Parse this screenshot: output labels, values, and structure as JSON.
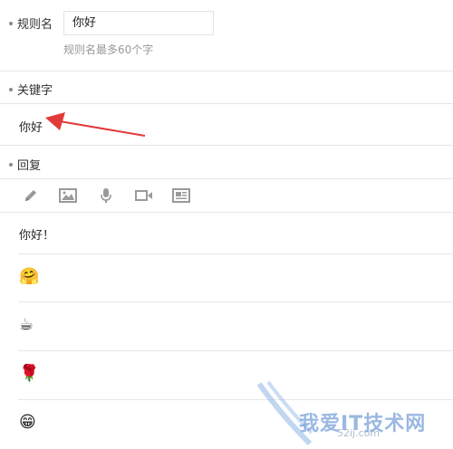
{
  "rule": {
    "label": "规则名",
    "value": "你好",
    "hint": "规则名最多60个字"
  },
  "keywords": {
    "label": "关键字",
    "items": [
      "你好"
    ]
  },
  "reply": {
    "label": "回复",
    "toolbar": [
      "pencil-icon",
      "image-icon",
      "microphone-icon",
      "video-icon",
      "news-icon"
    ],
    "text": "你好！",
    "emojis": [
      "🤗",
      "☕",
      "🌹",
      "😁"
    ]
  },
  "annotation": {
    "arrow_color": "#e23a3a"
  },
  "watermark": {
    "title": "我爱IT技术网",
    "subtitle": "52ij.com"
  }
}
